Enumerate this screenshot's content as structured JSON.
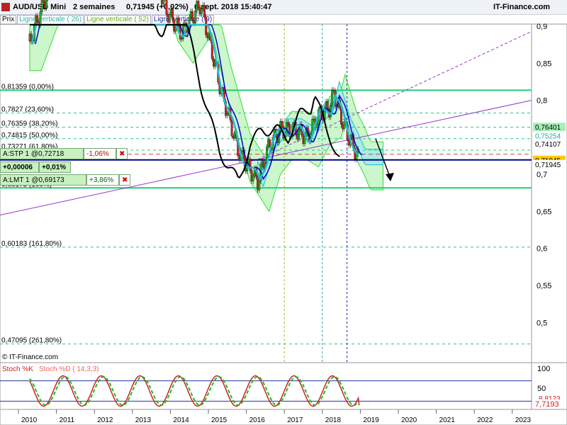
{
  "header": {
    "symbol": "AUD/USD Mini",
    "period": "2 semaines",
    "price": "0,71945 (+0,02%)",
    "datetime": "6 sept. 2018 15:40:47",
    "brand": "IT-Finance.com"
  },
  "toolbar": {
    "prix": "Prix",
    "vline26": "Ligne verticale ( 26)",
    "vline52": "Ligne verticale ( 52)",
    "vline9": "Ligne verticale ( 9)"
  },
  "watermark": "© IT-Finance.com",
  "orders": {
    "stp": {
      "label": "A:STP 1 @0,72718",
      "pct": "-1,06%",
      "close": "✖"
    },
    "stp_sub": {
      "a": "+0,00006",
      "b": "+0,01%"
    },
    "lmt": {
      "label": "A:LMT 1 @0,69173",
      "pct": "+3,86%",
      "close": "✖"
    }
  },
  "stoch": {
    "k_label": "Stoch %K",
    "d_label": "Stoch %D ( 14,3,3)",
    "axis": [
      "100",
      "50"
    ],
    "value_k": "7,7193",
    "value_d": "8,8123"
  },
  "colors": {
    "candle_up": "#22aa22",
    "candle_down": "#cc2222",
    "kijun": "#0000cc",
    "tenkan": "#22bbcc",
    "chikou": "#000000",
    "cloud_green": "#aaf0aa",
    "cloud_cyan": "#99e8f0",
    "fib": "#22cc77",
    "trend": "#9933cc"
  },
  "chart_data": {
    "type": "line",
    "title": "AUD/USD Mini",
    "xlabel": "",
    "ylabel": "",
    "x_ticks": [
      "2010",
      "2011",
      "2012",
      "2013",
      "2014",
      "2015",
      "2016",
      "2017",
      "2018",
      "2019",
      "2020",
      "2021",
      "2022",
      "2023"
    ],
    "y_ticks": [
      "0,9",
      "0,85",
      "0,8",
      "0,75",
      "0,7",
      "0,65",
      "0,6",
      "0,55",
      "0,5"
    ],
    "ylim": [
      0.45,
      0.93
    ],
    "grid": false,
    "fibonacci": [
      {
        "label": "0,81359 (0,00%)",
        "value": 0.8136
      },
      {
        "label": "0,7827 (23,60%)",
        "value": 0.7827
      },
      {
        "label": "0,76359 (38,20%)",
        "value": 0.7636
      },
      {
        "label": "0,74815 (50,00%)",
        "value": 0.7482
      },
      {
        "label": "0,73271 (61,80%)",
        "value": 0.7327
      },
      {
        "label": "0,68173 (100%)",
        "value": 0.6817
      },
      {
        "label": "0,60183 (161,80%)",
        "value": 0.6018
      },
      {
        "label": "0,47095 (261,80%)",
        "value": 0.471
      }
    ],
    "price_labels": [
      {
        "text": "0,76401",
        "value": 0.764
      },
      {
        "text": "0,75254",
        "value": 0.7525
      },
      {
        "text": "0,74107",
        "value": 0.7411
      },
      {
        "text": "0,71945",
        "value": 0.7195
      },
      {
        "text": "0,71945",
        "value": 0.7195
      }
    ],
    "series": [
      {
        "name": "AUD/USD Mini",
        "x": [
          2010.0,
          2010.5,
          2011.0,
          2011.3,
          2011.6,
          2012.0,
          2012.5,
          2013.0,
          2013.3,
          2013.6,
          2014.0,
          2014.5,
          2015.0,
          2015.5,
          2016.0,
          2016.3,
          2016.6,
          2017.0,
          2017.3,
          2017.6,
          2017.9,
          2018.0,
          2018.3,
          2018.5,
          2018.67
        ],
        "values": [
          0.88,
          0.95,
          1.03,
          1.08,
          1.05,
          1.02,
          1.04,
          1.05,
          0.97,
          0.92,
          0.89,
          0.93,
          0.82,
          0.73,
          0.69,
          0.74,
          0.76,
          0.76,
          0.75,
          0.78,
          0.79,
          0.81,
          0.76,
          0.74,
          0.719
        ]
      }
    ]
  }
}
